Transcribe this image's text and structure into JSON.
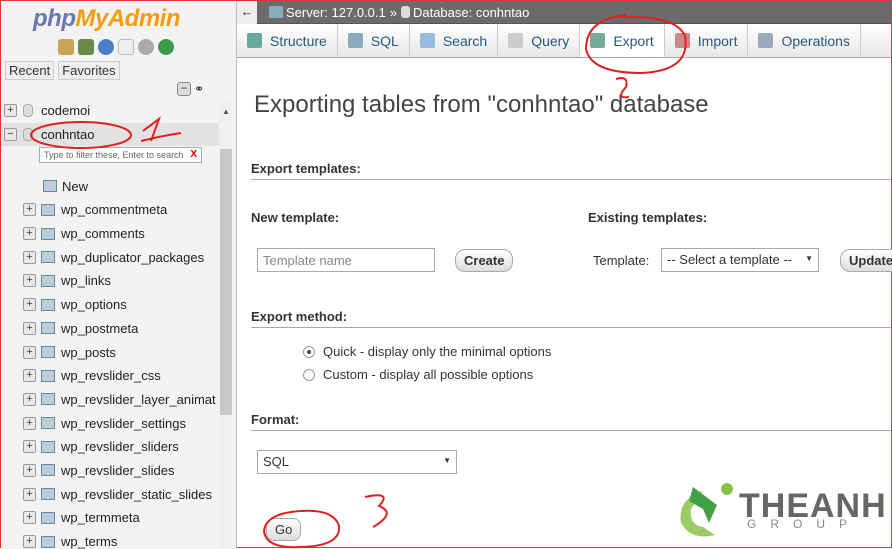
{
  "sidebar": {
    "logo": {
      "php": "php",
      "myadmin": "MyAdmin"
    },
    "tabs": [
      "Recent",
      "Favorites"
    ],
    "databases": [
      {
        "name": "codemoi",
        "expanded": false
      },
      {
        "name": "conhntao",
        "expanded": true
      }
    ],
    "filter_placeholder": "Type to filter these, Enter to search",
    "filter_clear": "X",
    "new_label": "New",
    "tables": [
      "wp_commentmeta",
      "wp_comments",
      "wp_duplicator_packages",
      "wp_links",
      "wp_options",
      "wp_postmeta",
      "wp_posts",
      "wp_revslider_css",
      "wp_revslider_layer_animat",
      "wp_revslider_settings",
      "wp_revslider_sliders",
      "wp_revslider_slides",
      "wp_revslider_static_slides",
      "wp_termmeta",
      "wp_terms"
    ]
  },
  "breadcrumb": {
    "back": "←",
    "server": "Server: 127.0.0.1",
    "sep": "»",
    "database": "Database: conhntao"
  },
  "tabs": [
    {
      "label": "Structure",
      "icon": "structure-icon",
      "color": "#6a9"
    },
    {
      "label": "SQL",
      "icon": "sql-icon",
      "color": "#8ab"
    },
    {
      "label": "Search",
      "icon": "search-icon",
      "color": "#9bd"
    },
    {
      "label": "Query",
      "icon": "query-icon",
      "color": "#ccc"
    },
    {
      "label": "Export",
      "icon": "export-icon",
      "color": "#7a9",
      "active": true
    },
    {
      "label": "Import",
      "icon": "import-icon",
      "color": "#c88"
    },
    {
      "label": "Operations",
      "icon": "wrench-icon",
      "color": "#9ab"
    }
  ],
  "main": {
    "title": "Exporting tables from \"conhntao\" database",
    "export_templates": "Export templates:",
    "new_template": "New template:",
    "template_placeholder": "Template name",
    "create": "Create",
    "existing_templates": "Existing templates:",
    "template_label": "Template:",
    "template_select": "-- Select a template --",
    "update": "Update",
    "export_method": "Export method:",
    "methods": [
      {
        "label": "Quick - display only the minimal options",
        "checked": true
      },
      {
        "label": "Custom - display all possible options",
        "checked": false
      }
    ],
    "format": "Format:",
    "format_value": "SQL",
    "go": "Go"
  },
  "annotations": [
    "1",
    "2",
    "3"
  ],
  "brand": {
    "name": "THEANH",
    "sub": "GROUP",
    "color": "#8bc34a"
  }
}
